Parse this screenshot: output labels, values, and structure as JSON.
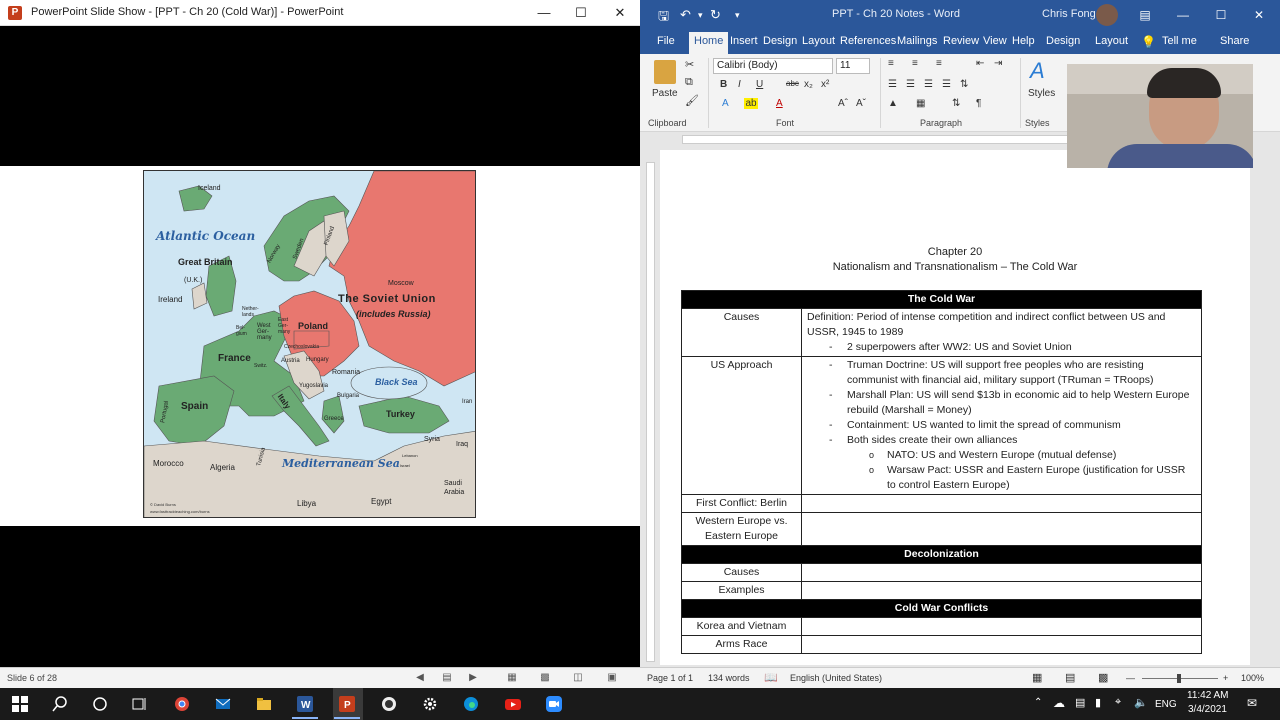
{
  "powerpoint": {
    "title": "PowerPoint Slide Show - [PPT - Ch 20 (Cold War)] - PowerPoint",
    "status": {
      "slide_indicator": "Slide 6 of 28"
    },
    "map": {
      "labels": [
        "Iceland",
        "Atlantic Ocean",
        "Great Britain",
        "(U.K.)",
        "Ireland",
        "Norway",
        "Sweden",
        "Finland",
        "Moscow",
        "The Soviet Union",
        "(includes Russia)",
        "Nether-lands",
        "Bel-gium",
        "West Ger-many",
        "East Ger-many",
        "Poland",
        "Czechoslovakia",
        "France",
        "Switz.",
        "Austria",
        "Hungary",
        "Romania",
        "Yugoslavia",
        "Bulgaria",
        "Black Sea",
        "Spain",
        "Portugal",
        "Italy",
        "Turkey",
        "Greece",
        "Iran",
        "Syria",
        "Iraq",
        "Lebanon",
        "Israel",
        "Mediterranean Sea",
        "Morocco",
        "Algeria",
        "Tunisia",
        "Libya",
        "Egypt",
        "Saudi Arabia",
        "© David Burns",
        "www.fasttrackteaching.com/burns"
      ]
    }
  },
  "word": {
    "title": "PPT - Ch 20 Notes - Word",
    "user": "Chris Fong",
    "tabs": [
      "File",
      "Home",
      "Insert",
      "Design",
      "Layout",
      "References",
      "Mailings",
      "Review",
      "View",
      "Help",
      "Design",
      "Layout"
    ],
    "tell_me": "Tell me",
    "share": "Share",
    "ribbon": {
      "paste": "Paste",
      "font_name": "Calibri (Body)",
      "font_size": "11",
      "styles": "Styles",
      "group_clipboard": "Clipboard",
      "group_font": "Font",
      "group_paragraph": "Paragraph",
      "group_styles": "Styles"
    },
    "document": {
      "heading1": "Chapter 20",
      "heading2": "Nationalism and Transnationalism – The Cold War",
      "sections": {
        "cold_war": "The Cold War",
        "decolonization": "Decolonization",
        "conflicts": "Cold War Conflicts"
      },
      "rows": {
        "causes_label": "Causes",
        "causes_def": "Definition: Period of intense competition and indirect conflict between US and USSR, 1945 to 1989",
        "causes_b1": "2 superpowers after WW2: US and Soviet Union",
        "us_label": "US Approach",
        "us_b1": "Truman Doctrine: US will support free peoples who are resisting communist with financial aid, military support (TRuman = TRoops)",
        "us_b2": "Marshall Plan: US will send $13b in economic aid to help Western Europe rebuild (Marshall = Money)",
        "us_b3": "Containment: US wanted to limit the spread of communism",
        "us_b4": "Both sides create their own alliances",
        "us_s1": "NATO: US and Western Europe (mutual defense)",
        "us_s2": "Warsaw Pact: USSR and Eastern Europe (justification for USSR to control Eastern Europe)",
        "berlin": "First Conflict: Berlin",
        "western": "Western Europe vs. Eastern Europe",
        "decol_causes": "Causes",
        "decol_examples": "Examples",
        "korea": "Korea and Vietnam",
        "arms": "Arms Race"
      }
    },
    "status": {
      "page": "Page 1 of 1",
      "words": "134 words",
      "language": "English (United States)",
      "zoom": "100%"
    }
  },
  "taskbar": {
    "language": "ENG",
    "time": "11:42 AM",
    "date": "3/4/2021"
  },
  "colors": {
    "word_blue": "#2b579a",
    "soviet_red": "#e8776f",
    "nato_green": "#6aaa74",
    "sea_blue": "#cfe6f3"
  }
}
